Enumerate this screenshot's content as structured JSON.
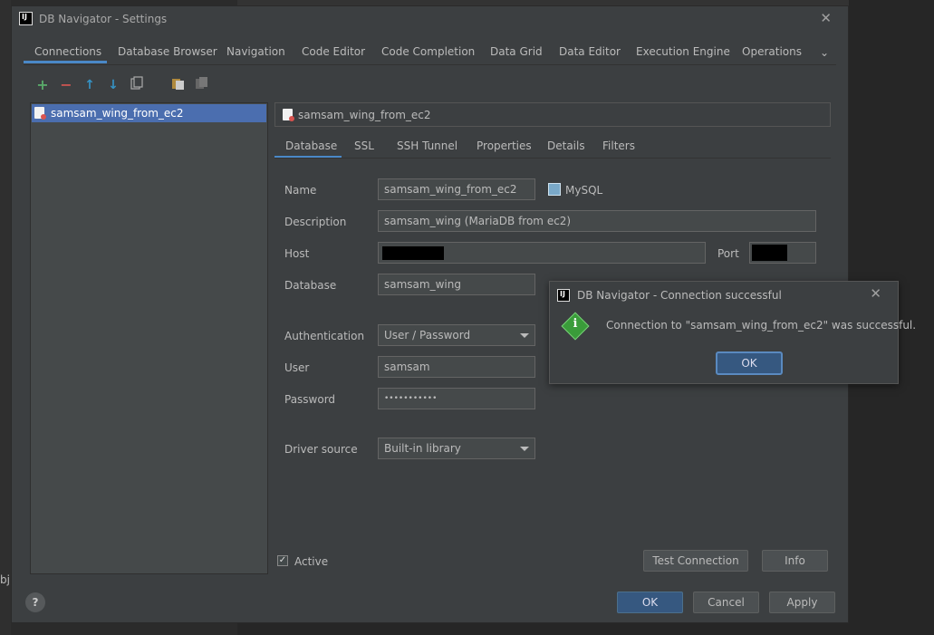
{
  "background": {
    "side_text": "bj"
  },
  "window": {
    "title": "DB Navigator - Settings",
    "close": "✕"
  },
  "tabs": [
    {
      "label": "Connections"
    },
    {
      "label": "Database Browser"
    },
    {
      "label": "Navigation"
    },
    {
      "label": "Code Editor"
    },
    {
      "label": "Code Completion"
    },
    {
      "label": "Data Grid"
    },
    {
      "label": "Data Editor"
    },
    {
      "label": "Execution Engine"
    },
    {
      "label": "Operations"
    }
  ],
  "tabs_more": "⌄",
  "toolbar": {
    "add": "+",
    "remove": "−",
    "up": "↑",
    "down": "↓"
  },
  "connections": [
    {
      "label": "samsam_wing_from_ec2"
    }
  ],
  "header": {
    "label": "samsam_wing_from_ec2"
  },
  "subtabs": [
    {
      "label": "Database"
    },
    {
      "label": "SSL"
    },
    {
      "label": "SSH Tunnel"
    },
    {
      "label": "Properties"
    },
    {
      "label": "Details"
    },
    {
      "label": "Filters"
    }
  ],
  "form": {
    "name_label": "Name",
    "name_value": "samsam_wing_from_ec2",
    "db_type": "MySQL",
    "description_label": "Description",
    "description_value": "samsam_wing (MariaDB from ec2)",
    "host_label": "Host",
    "port_label": "Port",
    "database_label": "Database",
    "database_value": "samsam_wing",
    "auth_label": "Authentication",
    "auth_value": "User / Password",
    "user_label": "User",
    "user_value": "samsam",
    "password_label": "Password",
    "password_value": "•••••••••••",
    "driver_label": "Driver source",
    "driver_value": "Built-in library"
  },
  "active": {
    "label": "Active",
    "check": "✓"
  },
  "buttons": {
    "test_connection": "Test Connection",
    "info": "Info",
    "ok": "OK",
    "cancel": "Cancel",
    "apply": "Apply",
    "help": "?"
  },
  "dialog": {
    "title": "DB Navigator - Connection successful",
    "message": "Connection to \"samsam_wing_from_ec2\" was successful.",
    "ok": "OK",
    "close": "✕",
    "info_glyph": "i"
  }
}
